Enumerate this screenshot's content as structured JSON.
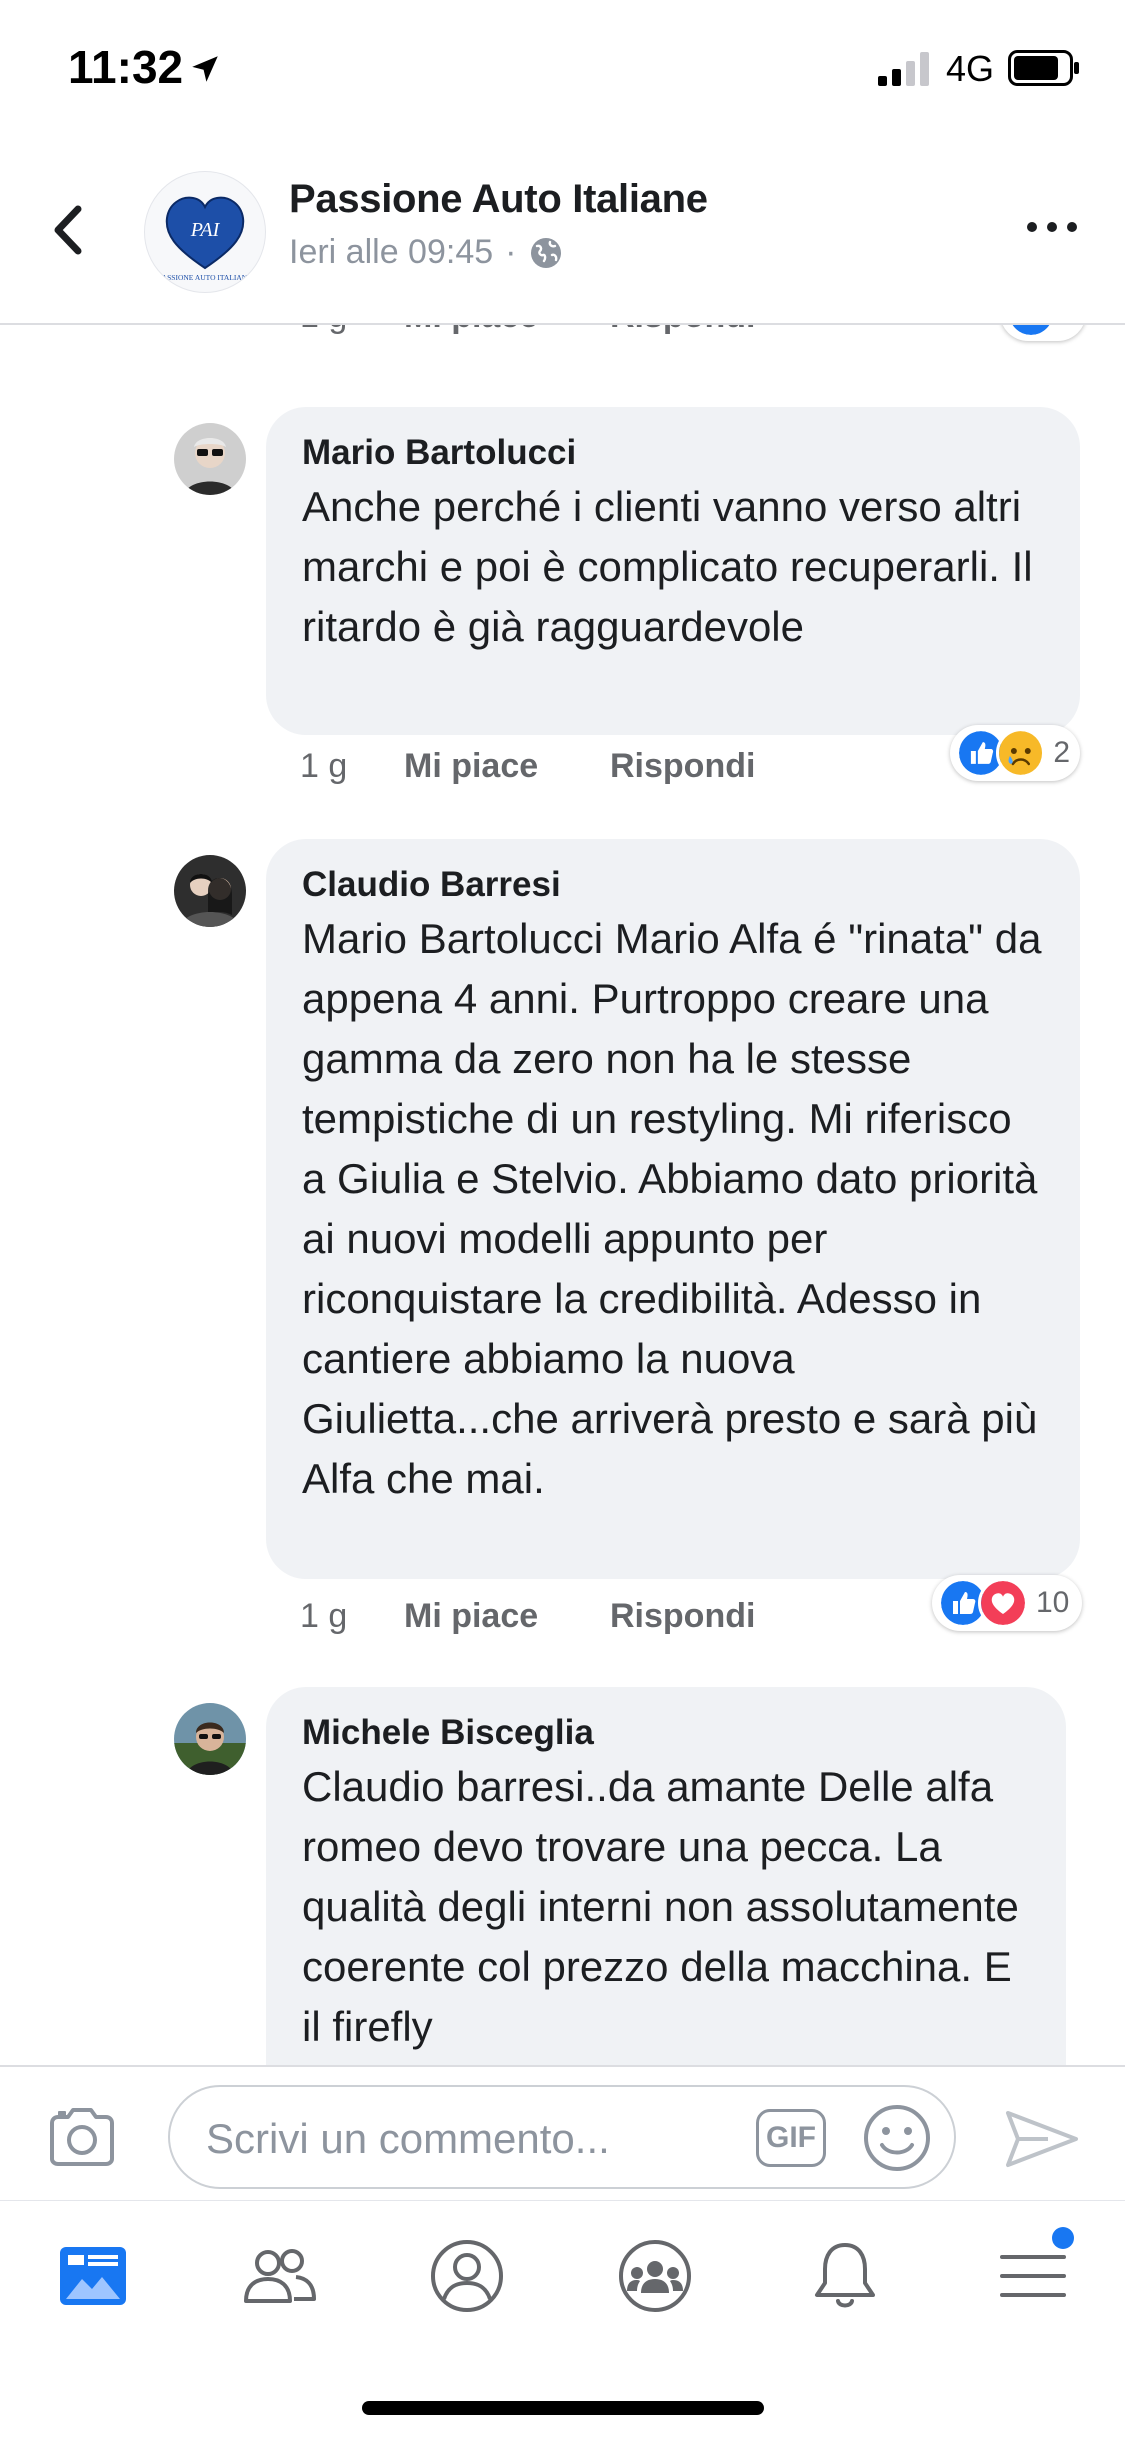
{
  "status_bar": {
    "time": "11:32",
    "network": "4G"
  },
  "header": {
    "page_name": "Passione Auto Italiane",
    "timestamp": "Ieri alle 09:45",
    "separator": "·",
    "logo_text": "PAI",
    "logo_subtext": "PASSIONE AUTO ITALIANE"
  },
  "actions": {
    "like": "Mi piace",
    "reply": "Rispondi"
  },
  "top_meta": {
    "time": "1 g"
  },
  "comments": [
    {
      "author": "Mario Bartolucci",
      "text": "Anche perché i clienti vanno verso altri marchi e poi è complicato recuperarli. Il ritardo è già ragguardevole",
      "time": "1 g",
      "reaction_count": "2"
    },
    {
      "author": "Claudio Barresi",
      "text": "Mario Bartolucci Mario Alfa é \"rinata\" da appena 4 anni. Purtroppo creare una gamma da zero non ha le stesse tempistiche di un restyling. Mi riferisco a Giulia e Stelvio. Abbiamo dato priorità ai nuovi modelli appunto per riconquistare la credibilità. Adesso in cantiere abbiamo la nuova Giulietta...che arriverà presto e sarà più Alfa che mai.",
      "time": "1 g",
      "reaction_count": "10"
    },
    {
      "author": "Michele Bisceglia",
      "text": "Claudio barresi..da amante Delle alfa romeo devo trovare una pecca. La qualità degli interni non assolutamente coerente col prezzo della macchina. E il firefly"
    }
  ],
  "composer": {
    "placeholder": "Scrivi un commento...",
    "gif_label": "GIF"
  },
  "colors": {
    "accent": "#1877f2",
    "like": "#1877f2",
    "love": "#f33e58",
    "bubble": "#f0f2f5"
  },
  "tabs": [
    "news-feed",
    "friends",
    "profile",
    "groups",
    "notifications",
    "menu"
  ]
}
